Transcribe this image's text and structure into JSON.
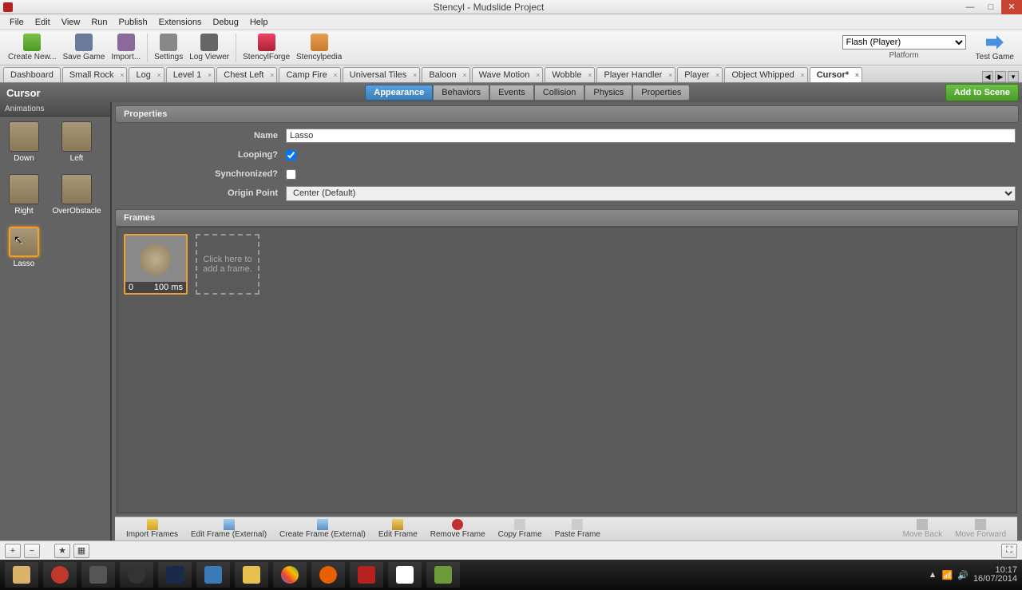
{
  "window": {
    "title": "Stencyl - Mudslide Project"
  },
  "menu": [
    "File",
    "Edit",
    "View",
    "Run",
    "Publish",
    "Extensions",
    "Debug",
    "Help"
  ],
  "toolbar": {
    "create": "Create New...",
    "save": "Save Game",
    "import": "Import...",
    "settings": "Settings",
    "log": "Log Viewer",
    "forge": "StencylForge",
    "pedia": "Stencylpedia",
    "platform_label": "Platform",
    "platform_value": "Flash (Player)",
    "test": "Test Game"
  },
  "tabs": [
    {
      "label": "Dashboard",
      "closable": false
    },
    {
      "label": "Small Rock"
    },
    {
      "label": "Log"
    },
    {
      "label": "Level 1"
    },
    {
      "label": "Chest Left"
    },
    {
      "label": "Camp Fire"
    },
    {
      "label": "Universal Tiles"
    },
    {
      "label": "Baloon"
    },
    {
      "label": "Wave Motion"
    },
    {
      "label": "Wobble"
    },
    {
      "label": "Player Handler"
    },
    {
      "label": "Player"
    },
    {
      "label": "Object Whipped"
    },
    {
      "label": "Cursor*",
      "active": true
    }
  ],
  "subhead": {
    "title": "Cursor",
    "tabs": [
      "Appearance",
      "Behaviors",
      "Events",
      "Collision",
      "Physics",
      "Properties"
    ],
    "active": "Appearance",
    "add": "Add to Scene"
  },
  "sidebar": {
    "header": "Animations",
    "items": [
      {
        "label": "Down"
      },
      {
        "label": "Left"
      },
      {
        "label": "Right"
      },
      {
        "label": "OverObstacle"
      },
      {
        "label": "Lasso",
        "selected": true
      }
    ]
  },
  "props": {
    "header": "Properties",
    "name_label": "Name",
    "name_value": "Lasso",
    "looping_label": "Looping?",
    "looping": true,
    "sync_label": "Synchronized?",
    "sync": false,
    "origin_label": "Origin Point",
    "origin_value": "Center (Default)"
  },
  "frames": {
    "header": "Frames",
    "frame0": {
      "index": "0",
      "ms": "100 ms"
    },
    "add_hint": "Click here to add a frame."
  },
  "framebar": {
    "import": "Import Frames",
    "editext": "Edit Frame (External)",
    "createext": "Create Frame (External)",
    "edit": "Edit Frame",
    "remove": "Remove Frame",
    "copy": "Copy Frame",
    "paste": "Paste Frame",
    "back": "Move Back",
    "fwd": "Move Forward"
  },
  "tray": {
    "time": "10:17",
    "date": "16/07/2014"
  }
}
